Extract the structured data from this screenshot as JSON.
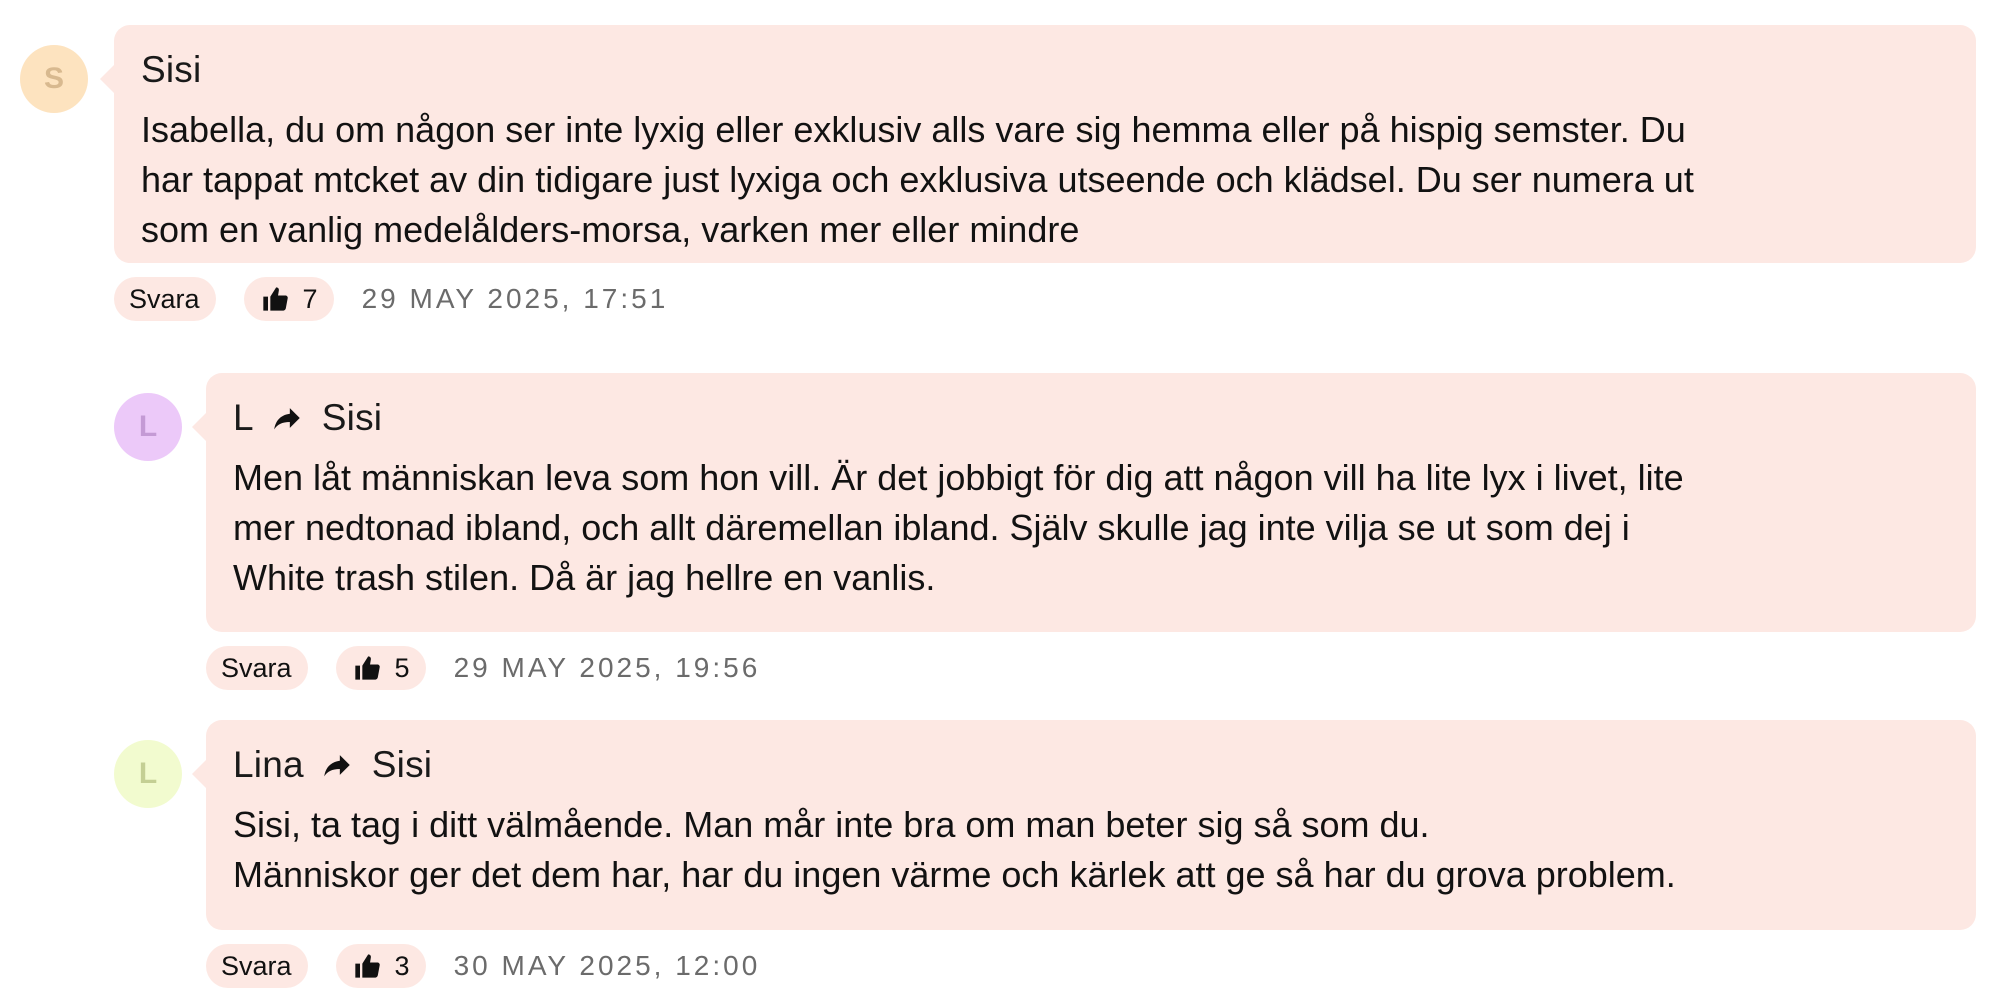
{
  "comments": [
    {
      "avatar_initial": "S",
      "author": "Sisi",
      "reply_to": "",
      "body": "Isabella, du om någon ser inte lyxig eller exklusiv alls vare sig hemma eller på hispig semster. Du\nhar tappat mtcket av din tidigare just lyxiga och exklusiva utseende och klädsel. Du ser numera ut\nsom en vanlig medelålders-morsa, varken mer eller mindre",
      "reply_label": "Svara",
      "likes": "7",
      "timestamp": "29 MAY 2025, 17:51"
    },
    {
      "avatar_initial": "L",
      "author": "L",
      "reply_to": "Sisi",
      "body": "Men låt människan leva som hon vill. Är det jobbigt för dig att någon vill ha lite lyx i livet, lite\nmer nedtonad ibland, och allt däremellan ibland. Själv skulle jag inte vilja se ut som dej i\nWhite trash stilen. Då är jag hellre en vanlis.",
      "reply_label": "Svara",
      "likes": "5",
      "timestamp": "29 MAY 2025, 19:56"
    },
    {
      "avatar_initial": "L",
      "author": "Lina",
      "reply_to": "Sisi",
      "body": "Sisi, ta tag i ditt välmående. Man mår inte bra om man beter sig så som du.\nMänniskor ger det dem har, har du ingen värme och kärlek att ge så har du grova problem.",
      "reply_label": "Svara",
      "likes": "3",
      "timestamp": "30 MAY 2025, 12:00"
    }
  ],
  "icons": {
    "reply_arrow": "reply-arrow-icon",
    "like": "thumbs-up-icon"
  },
  "colors": {
    "bubble_background": "#fde8e3",
    "avatar_1": "#fde3bf",
    "avatar_2": "#ecc9f9",
    "avatar_3": "#f2fbcf",
    "timestamp_text": "#6b6b6b"
  }
}
